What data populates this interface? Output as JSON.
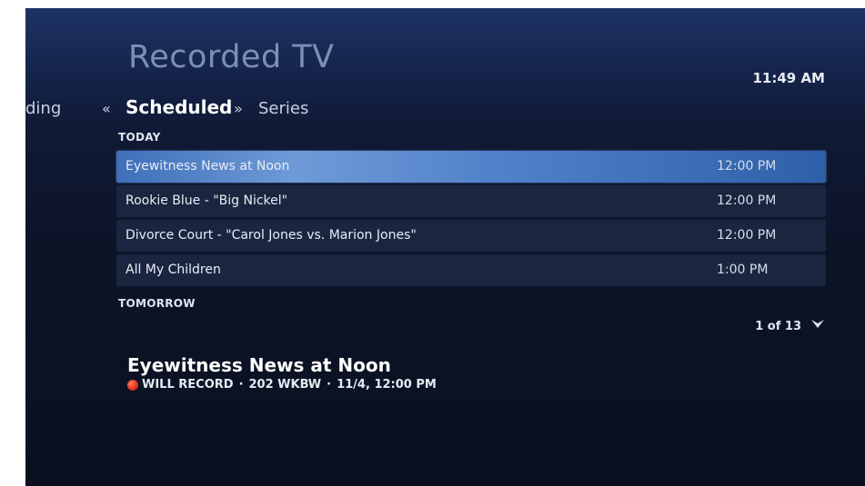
{
  "header": {
    "title": "Recorded TV",
    "clock": "11:49 AM"
  },
  "pivots": {
    "previous": "ding",
    "current": "Scheduled",
    "next": "Series",
    "left_arrow": "«",
    "right_arrow": "»"
  },
  "sections": {
    "today": "TODAY",
    "tomorrow": "TOMORROW"
  },
  "today_items": [
    {
      "name": "Eyewitness News at Noon",
      "time": "12:00 PM",
      "selected": true
    },
    {
      "name": "Rookie Blue - \"Big Nickel\"",
      "time": "12:00 PM",
      "selected": false
    },
    {
      "name": "Divorce Court - \"Carol Jones vs. Marion Jones\"",
      "time": "12:00 PM",
      "selected": false
    },
    {
      "name": "All My Children",
      "time": "1:00 PM",
      "selected": false
    }
  ],
  "pager": {
    "text": "1 of 13",
    "icon": "chevron-down-icon"
  },
  "details": {
    "title": "Eyewitness News at Noon",
    "status": "WILL RECORD",
    "channel": "202 WKBW",
    "datetime": "11/4, 12:00 PM",
    "separator": "·",
    "status_icon": "record-dot-icon",
    "status_color": "#e0301e"
  },
  "colors": {
    "selection": "#4f80c8",
    "background": "#0c1428"
  }
}
